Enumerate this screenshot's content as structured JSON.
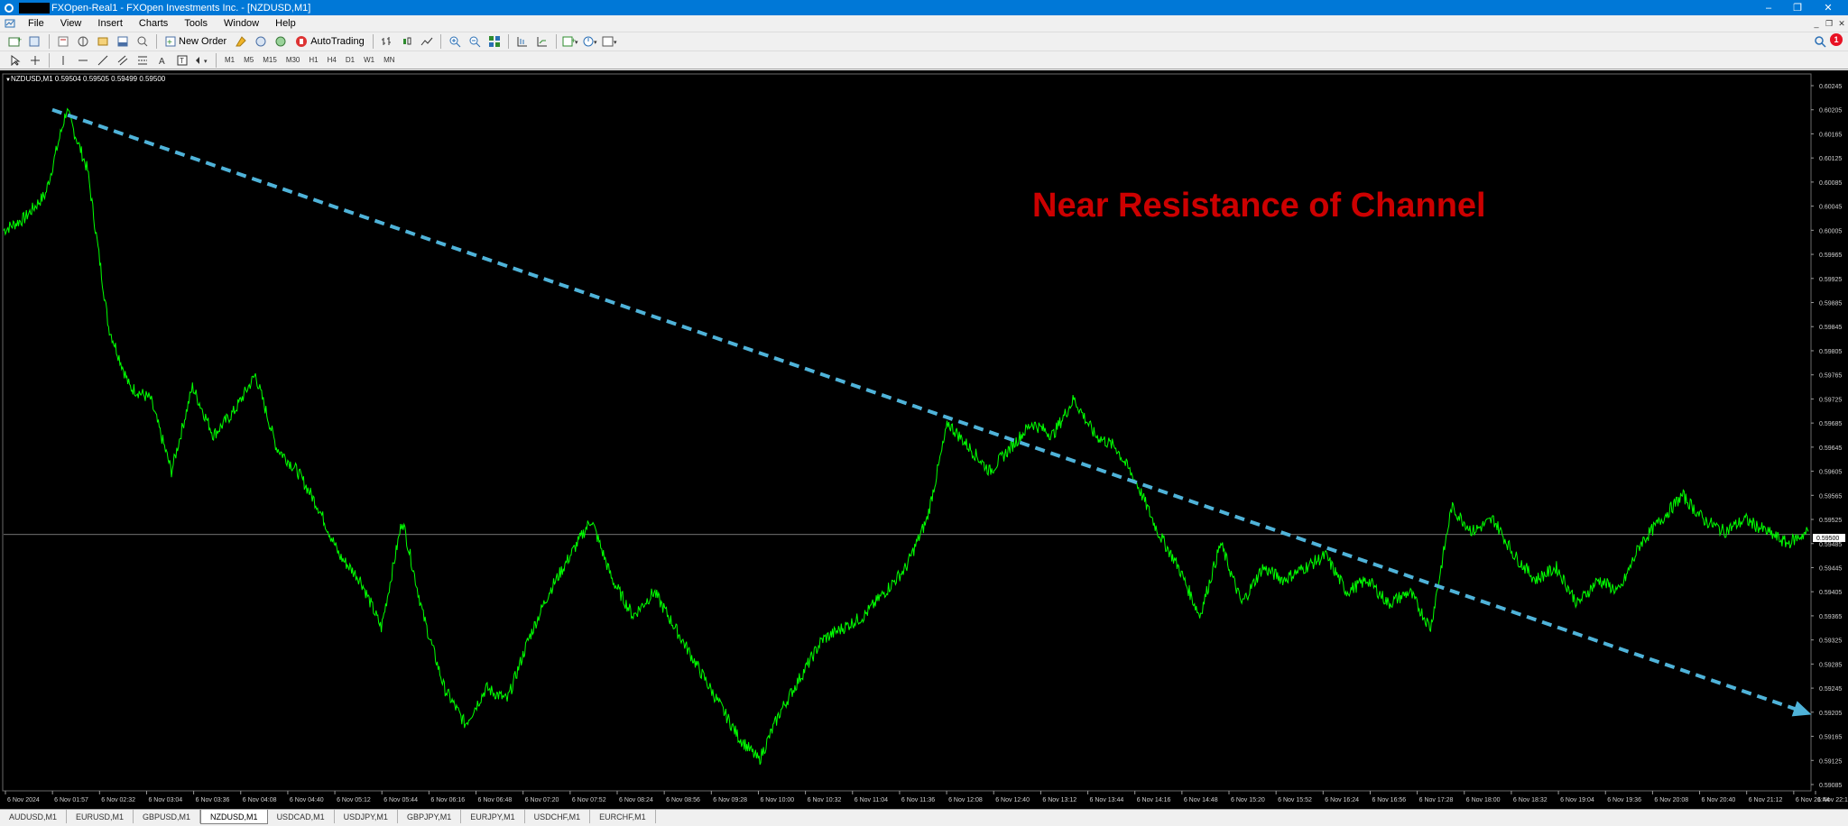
{
  "window": {
    "title": "FXOpen-Real1 - FXOpen Investments Inc. - [NZDUSD,M1]",
    "controls": [
      "–",
      "❐",
      "✕"
    ]
  },
  "menu": [
    "File",
    "View",
    "Insert",
    "Charts",
    "Tools",
    "Window",
    "Help"
  ],
  "toolbar": {
    "new_order_label": "New Order",
    "autotrading_label": "AutoTrading",
    "notification_count": "1"
  },
  "timeframes": [
    "M1",
    "M5",
    "M15",
    "M30",
    "H1",
    "H4",
    "D1",
    "W1",
    "MN"
  ],
  "chart": {
    "info": "NZDUSD,M1  0.59504 0.59505 0.59499 0.59500",
    "annotation": "Near Resistance of Channel",
    "current_price": "0.59500",
    "line_color": "#00ff00",
    "trendline_color": "#4fb3d9",
    "annotation_color": "#cc0000"
  },
  "chart_data": {
    "type": "line",
    "symbol": "NZDUSD",
    "timeframe": "M1",
    "ylim": [
      0.59085,
      0.60245
    ],
    "y_ticks": [
      "0.60245",
      "0.60205",
      "0.60165",
      "0.60125",
      "0.60085",
      "0.60045",
      "0.60005",
      "0.59965",
      "0.59925",
      "0.59885",
      "0.59845",
      "0.59805",
      "0.59765",
      "0.59725",
      "0.59685",
      "0.59645",
      "0.59605",
      "0.59565",
      "0.59525",
      "0.59485",
      "0.59445",
      "0.59405",
      "0.59365",
      "0.59325",
      "0.59285",
      "0.59245",
      "0.59205",
      "0.59165",
      "0.59125",
      "0.59085"
    ],
    "x_ticks": [
      "6 Nov 2024",
      "6 Nov 01:57",
      "6 Nov 02:32",
      "6 Nov 03:04",
      "6 Nov 03:36",
      "6 Nov 04:08",
      "6 Nov 04:40",
      "6 Nov 05:12",
      "6 Nov 05:44",
      "6 Nov 06:16",
      "6 Nov 06:48",
      "6 Nov 07:20",
      "6 Nov 07:52",
      "6 Nov 08:24",
      "6 Nov 08:56",
      "6 Nov 09:28",
      "6 Nov 10:00",
      "6 Nov 10:32",
      "6 Nov 11:04",
      "6 Nov 11:36",
      "6 Nov 12:08",
      "6 Nov 12:40",
      "6 Nov 13:12",
      "6 Nov 13:44",
      "6 Nov 14:16",
      "6 Nov 14:48",
      "6 Nov 15:20",
      "6 Nov 15:52",
      "6 Nov 16:24",
      "6 Nov 16:56",
      "6 Nov 17:28",
      "6 Nov 18:00",
      "6 Nov 18:32",
      "6 Nov 19:04",
      "6 Nov 19:36",
      "6 Nov 20:08",
      "6 Nov 20:40",
      "6 Nov 21:12",
      "6 Nov 21:44",
      "6 Nov 22:16"
    ],
    "series": [
      {
        "values": [
          0.60005,
          0.60025,
          0.60065,
          0.60205,
          0.60105,
          0.59845,
          0.59745,
          0.59725,
          0.59605,
          0.59745,
          0.59665,
          0.59705,
          0.59765,
          0.59645,
          0.59605,
          0.59545,
          0.59465,
          0.59425,
          0.59345,
          0.59525,
          0.59365,
          0.59245,
          0.59185,
          0.59245,
          0.59225,
          0.59325,
          0.59405,
          0.59465,
          0.59525,
          0.59425,
          0.59365,
          0.59405,
          0.59345,
          0.59285,
          0.59225,
          0.59165,
          0.59125,
          0.59205,
          0.59265,
          0.59325,
          0.59345,
          0.59365,
          0.59405,
          0.59445,
          0.59525,
          0.59685,
          0.59645,
          0.59605,
          0.59645,
          0.59685,
          0.59665,
          0.59725,
          0.59665,
          0.59645,
          0.59585,
          0.59505,
          0.59445,
          0.59365,
          0.59485,
          0.59385,
          0.59445,
          0.59425,
          0.59445,
          0.59465,
          0.59405,
          0.59425,
          0.59385,
          0.59405,
          0.59345,
          0.59545,
          0.59505,
          0.59525,
          0.59465,
          0.59425,
          0.59445,
          0.59385,
          0.59425,
          0.59405,
          0.59485,
          0.59525,
          0.59565,
          0.59525,
          0.59505,
          0.59525,
          0.59505,
          0.59485,
          0.59505
        ]
      },
      {
        "name": "trendline",
        "values": [
          0.60205,
          0.59205
        ]
      }
    ],
    "hline": 0.595,
    "grid": false
  }
}
